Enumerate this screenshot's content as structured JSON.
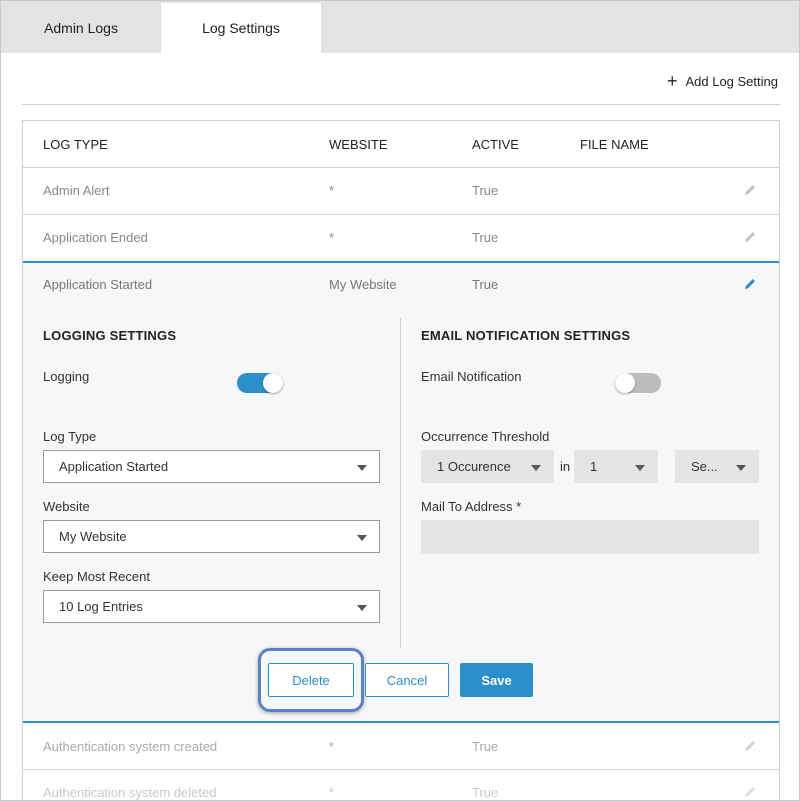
{
  "tabs": [
    {
      "label": "Admin Logs",
      "active": false
    },
    {
      "label": "Log Settings",
      "active": true
    }
  ],
  "toolbar": {
    "add_label": "Add Log Setting"
  },
  "table": {
    "columns": [
      "LOG TYPE",
      "WEBSITE",
      "ACTIVE",
      "FILE NAME"
    ],
    "rows_before": [
      {
        "type": "Admin Alert",
        "website": "*",
        "active": "True"
      },
      {
        "type": "Application Ended",
        "website": "*",
        "active": "True"
      }
    ],
    "expanded_row": {
      "type": "Application Started",
      "website": "My Website",
      "active": "True"
    },
    "rows_after": [
      {
        "type": "Authentication system created",
        "website": "*",
        "active": "True"
      },
      {
        "type": "Authentication system deleted",
        "website": "*",
        "active": "True"
      }
    ]
  },
  "logging": {
    "title": "LOGGING SETTINGS",
    "logging_label": "Logging",
    "logging_on": true,
    "log_type_label": "Log Type",
    "log_type_value": "Application Started",
    "website_label": "Website",
    "website_value": "My Website",
    "keep_label": "Keep Most Recent",
    "keep_value": "10 Log Entries"
  },
  "email": {
    "title": "EMAIL NOTIFICATION SETTINGS",
    "notification_label": "Email Notification",
    "notification_on": false,
    "threshold_label": "Occurrence Threshold",
    "occurrence_value": "1 Occurence",
    "in_label": "in",
    "count_value": "1",
    "unit_value": "Se...",
    "mail_label": "Mail To Address *",
    "mail_value": ""
  },
  "actions": {
    "delete": "Delete",
    "cancel": "Cancel",
    "save": "Save"
  },
  "colors": {
    "accent": "#2a8fca",
    "focus": "#5c82c4"
  }
}
